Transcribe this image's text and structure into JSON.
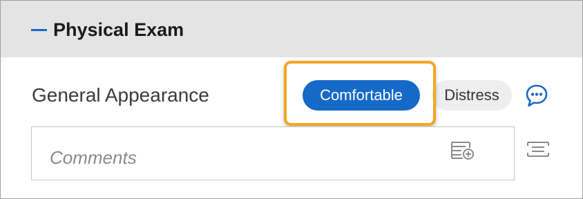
{
  "section": {
    "title": "Physical Exam",
    "collapse_icon": "minus-icon"
  },
  "general_appearance": {
    "label": "General Appearance",
    "options": [
      {
        "label": "Comfortable",
        "selected": true
      },
      {
        "label": "Distress",
        "selected": false
      }
    ],
    "comment_icon": "comment-bubble-icon",
    "comments": {
      "value": "",
      "placeholder": "Comments",
      "add_icon": "add-note-icon"
    },
    "template_icon": "template-list-icon"
  },
  "colors": {
    "accent": "#1569c7",
    "highlight": "#f5a623",
    "header_bg": "#e4e4e4"
  }
}
